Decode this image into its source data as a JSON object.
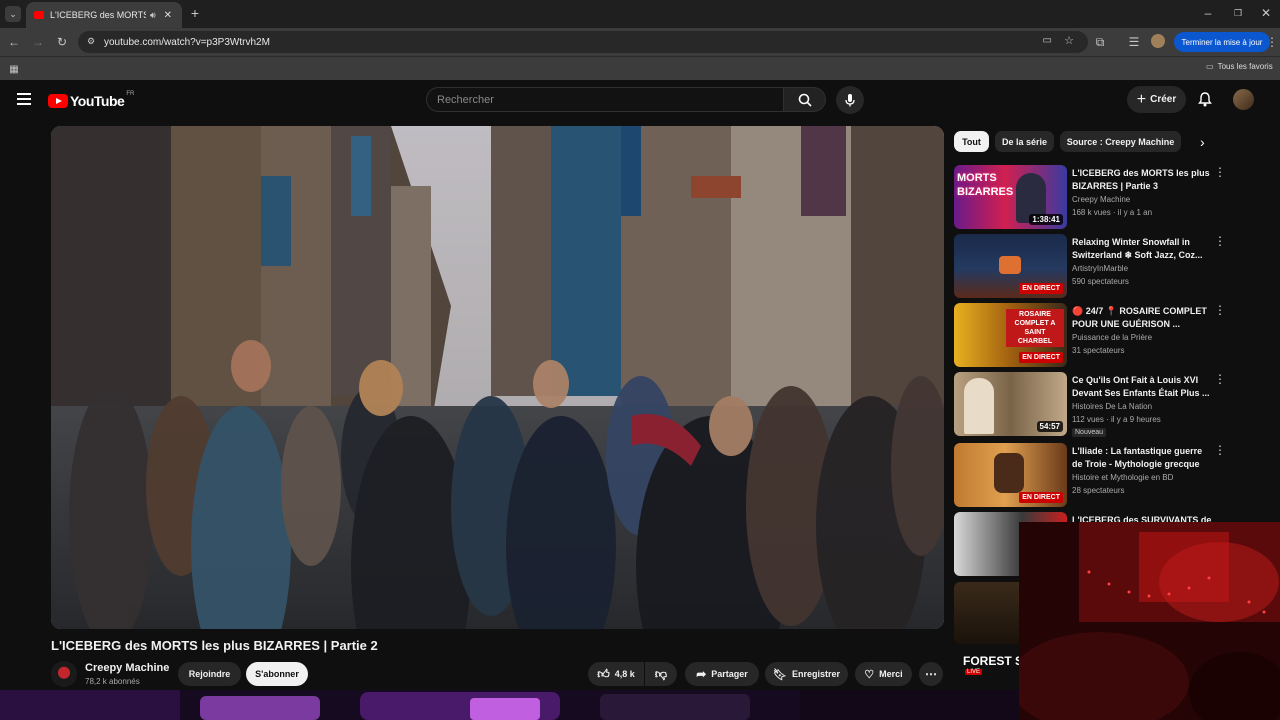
{
  "browser": {
    "tab_title": "L'ICEBERG des MORTS les plus BIZARRES | Partie 2",
    "url": "youtube.com/watch?v=p3P3Wtrvh2M",
    "update_button": "Terminer la mise à jour",
    "bookmarks_all": "Tous les favoris"
  },
  "masthead": {
    "logo_text": "YouTube",
    "logo_country": "FR",
    "search_placeholder": "Rechercher",
    "create_label": "Créer"
  },
  "video": {
    "title": "L'ICEBERG des MORTS les plus BIZARRES | Partie 2",
    "channel": "Creepy Machine",
    "subscribers": "78,2 k abonnés",
    "join_label": "Rejoindre",
    "subscribe_label": "S'abonner",
    "likes": "4,8 k",
    "share_label": "Partager",
    "save_label": "Enregistrer",
    "thanks_label": "Merci"
  },
  "sidebar": {
    "chips": [
      "Tout",
      "De la série",
      "Source : Creepy Machine"
    ],
    "recommendations": [
      {
        "title": "L'ICEBERG des MORTS les plus BIZARRES | Partie 3",
        "channel": "Creepy Machine",
        "meta": "168 k vues · il y a 1 an",
        "duration": "1:38:41",
        "thumb_text": "MORTS BIZARRES"
      },
      {
        "title": "Relaxing Winter Snowfall in Switzerland ❄ Soft Jazz, Coz...",
        "channel": "ArtistryInMarble",
        "meta": "590 spectateurs",
        "live": "EN DIRECT"
      },
      {
        "title": "🔴 24/7 📍 ROSAIRE COMPLET POUR UNE GUÉRISON ...",
        "channel": "Puissance de la Prière",
        "meta": "31 spectateurs",
        "live": "EN DIRECT",
        "thumb_text": "ROSAIRE COMPLET A SAINT CHARBEL"
      },
      {
        "title": "Ce Qu'ils Ont Fait à Louis XVI Devant Ses Enfants Était Plus ...",
        "channel": "Histoires De La Nation",
        "meta": "112 vues · il y a 9 heures",
        "duration": "54:57",
        "badge": "Nouveau"
      },
      {
        "title": "L'Iliade : La fantastique guerre de Troie - Mythologie grecque",
        "channel": "Histoire et Mythologie en BD",
        "meta": "28 spectateurs",
        "live": "EN DIRECT"
      },
      {
        "title": "L'ICEBERG des SURVIVANTS de",
        "channel": "",
        "meta": ""
      }
    ]
  },
  "overlay": {
    "bottom_text": "FOREST S",
    "live_text": "LIVE"
  },
  "colors": {
    "accent_red": "#ff0000",
    "update_blue": "#0b57d0",
    "background": "#0f0f0f"
  }
}
